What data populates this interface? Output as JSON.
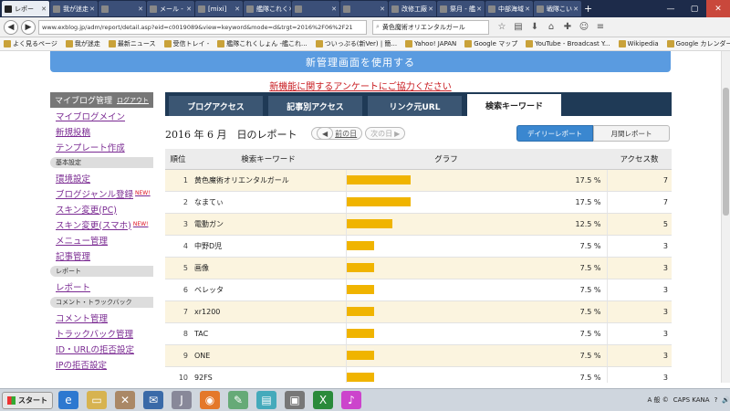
{
  "browser": {
    "tabs": [
      {
        "title": "レポー",
        "active": true
      },
      {
        "title": "我が迷走",
        "active": false
      },
      {
        "title": "",
        "active": false
      },
      {
        "title": "メール -",
        "active": false
      },
      {
        "title": "[mixi]",
        "active": false
      },
      {
        "title": "艦隊これく",
        "active": false
      },
      {
        "title": "",
        "active": false
      },
      {
        "title": "",
        "active": false
      },
      {
        "title": "改修工廠",
        "active": false
      },
      {
        "title": "祭月 - 艦",
        "active": false
      },
      {
        "title": "中部海域",
        "active": false
      },
      {
        "title": "戦隊こい",
        "active": false
      }
    ],
    "url": "www.exblog.jp/adm/report/detail.asp?eid=c0019089&view=keyword&mode=d&trgt=2016%2F06%2F21",
    "search_value": "黄色魔術オリエンタルガール",
    "bookmarks": [
      "よく見るページ",
      "我が迷走",
      "最新ニュース",
      "受信トレイ -",
      "艦隊これくしょん -艦これ...",
      "ついっぷる(新Ver) | 簡...",
      "Yahoo! JAPAN",
      "Google マップ",
      "YouTube - Broadcast Y...",
      "Wikipedia",
      "Google カレンダー"
    ]
  },
  "banner": "新管理画面を使用する",
  "survey_link": "新機能に関するアンケートにご協力ください",
  "sidebar": {
    "header": "マイブログ管理",
    "logout": "ログアウト",
    "groups": [
      {
        "section": "",
        "items": [
          {
            "label": "マイブログメイン",
            "new": ""
          },
          {
            "label": "新規投稿",
            "new": ""
          },
          {
            "label": "テンプレート作成",
            "new": ""
          }
        ]
      },
      {
        "section": "基本設定",
        "items": [
          {
            "label": "環境設定",
            "new": ""
          },
          {
            "label": "ブログジャンル登録",
            "new": "NEW!"
          },
          {
            "label": "スキン変更(PC)",
            "new": ""
          },
          {
            "label": "スキン変更(スマホ)",
            "new": "NEW!"
          },
          {
            "label": "メニュー管理",
            "new": ""
          },
          {
            "label": "記事管理",
            "new": ""
          }
        ]
      },
      {
        "section": "レポート",
        "items": [
          {
            "label": "レポート",
            "new": ""
          }
        ]
      },
      {
        "section": "コメント・トラックバック",
        "items": [
          {
            "label": "コメント管理",
            "new": ""
          },
          {
            "label": "トラックバック管理",
            "new": ""
          },
          {
            "label": "ID・URLの拒否設定",
            "new": ""
          },
          {
            "label": "IPの拒否設定",
            "new": ""
          }
        ]
      }
    ]
  },
  "report": {
    "tabs": [
      {
        "label": "ブログアクセス",
        "active": false
      },
      {
        "label": "記事別アクセス",
        "active": false
      },
      {
        "label": "リンク元URL",
        "active": false
      },
      {
        "label": "検索キーワード",
        "active": true
      }
    ],
    "title": "2016 年 6 月　日のレポート",
    "prev_day": "前の日",
    "next_day": "次の日",
    "daily_label": "デイリーレポート",
    "monthly_label": "月間レポート",
    "columns": [
      "順位",
      "検索キーワード",
      "グラフ",
      "",
      "アクセス数"
    ],
    "rows": [
      {
        "rank": "1",
        "keyword": "黄色魔術オリエンタルガール",
        "percent_value": 17.5,
        "percent": "17.5 %",
        "count": "7"
      },
      {
        "rank": "2",
        "keyword": "なまてぃ",
        "percent_value": 17.5,
        "percent": "17.5 %",
        "count": "7"
      },
      {
        "rank": "3",
        "keyword": "電動ガン",
        "percent_value": 12.5,
        "percent": "12.5 %",
        "count": "5"
      },
      {
        "rank": "4",
        "keyword": "中野D児",
        "percent_value": 7.5,
        "percent": "7.5 %",
        "count": "3"
      },
      {
        "rank": "5",
        "keyword": "画像",
        "percent_value": 7.5,
        "percent": "7.5 %",
        "count": "3"
      },
      {
        "rank": "6",
        "keyword": "ベレッタ",
        "percent_value": 7.5,
        "percent": "7.5 %",
        "count": "3"
      },
      {
        "rank": "7",
        "keyword": "xr1200",
        "percent_value": 7.5,
        "percent": "7.5 %",
        "count": "3"
      },
      {
        "rank": "8",
        "keyword": "TAC",
        "percent_value": 7.5,
        "percent": "7.5 %",
        "count": "3"
      },
      {
        "rank": "9",
        "keyword": "ONE",
        "percent_value": 7.5,
        "percent": "7.5 %",
        "count": "3"
      },
      {
        "rank": "10",
        "keyword": "92FS",
        "percent_value": 7.5,
        "percent": "7.5 %",
        "count": "3"
      }
    ]
  },
  "taskbar": {
    "start": "スタート",
    "tray": [
      "CAPS KANA",
      "A 般 ©",
      "?"
    ]
  }
}
